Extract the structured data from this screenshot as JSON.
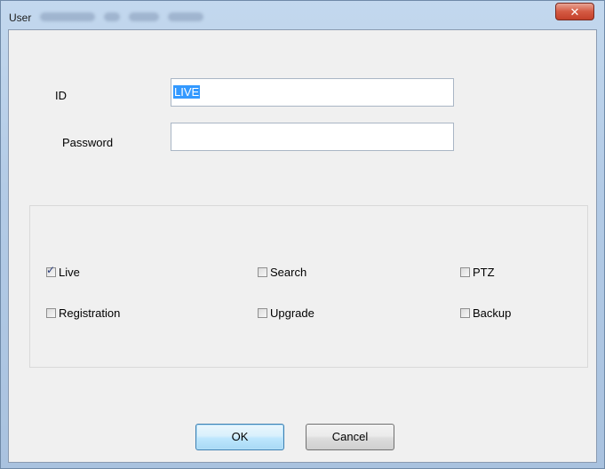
{
  "window": {
    "title": "User",
    "close_glyph": "✕"
  },
  "form": {
    "id_label": "ID",
    "id_value": "LIVE",
    "password_label": "Password",
    "password_value": ""
  },
  "permissions": [
    {
      "label": "Live",
      "checked": true
    },
    {
      "label": "Search",
      "checked": false
    },
    {
      "label": "PTZ",
      "checked": false
    },
    {
      "label": "Registration",
      "checked": false
    },
    {
      "label": "Upgrade",
      "checked": false
    },
    {
      "label": "Backup",
      "checked": false
    }
  ],
  "buttons": {
    "ok_label": "OK",
    "cancel_label": "Cancel"
  },
  "icons": {
    "close": "close-icon",
    "check": "checkmark-icon"
  },
  "colors": {
    "selection": "#3399ff",
    "close_button": "#c3402a",
    "default_button_border": "#3c7fb1"
  }
}
